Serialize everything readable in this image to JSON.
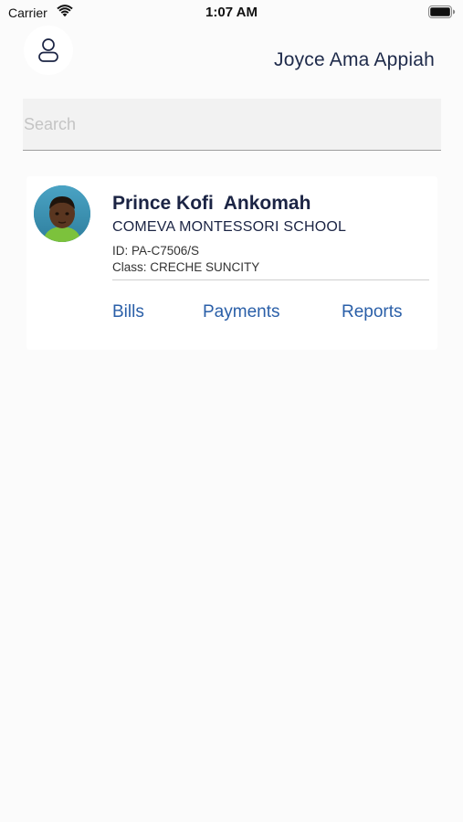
{
  "status_bar": {
    "carrier": "Carrier",
    "time": "1:07 AM"
  },
  "header": {
    "user_name": "Joyce Ama Appiah",
    "profile_icon": "person-icon"
  },
  "search": {
    "placeholder": "Search",
    "value": ""
  },
  "students": [
    {
      "name": "Prince Kofi  Ankomah",
      "school": "COMEVA MONTESSORI SCHOOL",
      "id_text": "ID: PA-C7506/S",
      "class_text": "Class: CRECHE SUNCITY",
      "links": {
        "bills": "Bills",
        "payments": "Payments",
        "reports": "Reports"
      }
    }
  ],
  "colors": {
    "link": "#2a5fa8",
    "name_text": "#1b2444",
    "background": "#fbfbfb"
  }
}
